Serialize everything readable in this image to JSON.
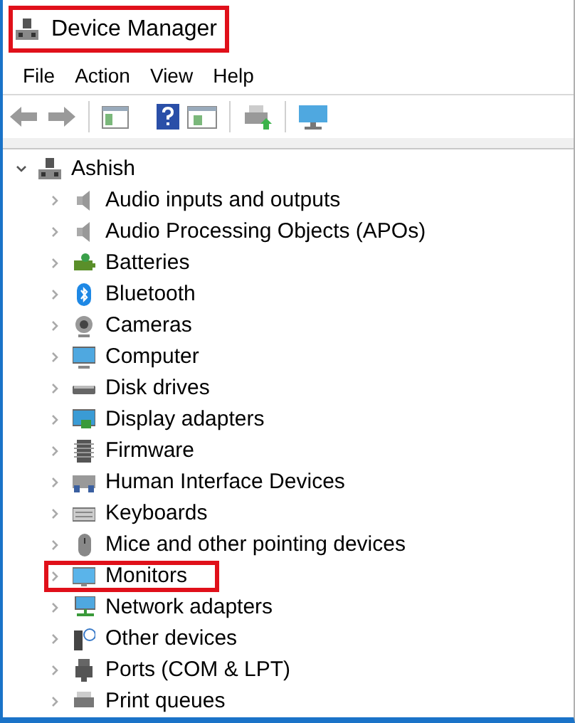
{
  "window": {
    "title": "Device Manager",
    "highlighted": true
  },
  "menu": [
    {
      "label": "File"
    },
    {
      "label": "Action"
    },
    {
      "label": "View"
    },
    {
      "label": "Help"
    }
  ],
  "tree": {
    "label": "Ashish",
    "expanded": true,
    "highlighted": false,
    "children": [
      {
        "label": "Audio inputs and outputs",
        "expanded": false,
        "highlighted": false
      },
      {
        "label": "Audio Processing Objects (APOs)",
        "expanded": false,
        "highlighted": false
      },
      {
        "label": "Batteries",
        "expanded": false,
        "highlighted": false
      },
      {
        "label": "Bluetooth",
        "expanded": false,
        "highlighted": false
      },
      {
        "label": "Cameras",
        "expanded": false,
        "highlighted": false
      },
      {
        "label": "Computer",
        "expanded": false,
        "highlighted": false
      },
      {
        "label": "Disk drives",
        "expanded": false,
        "highlighted": false
      },
      {
        "label": "Display adapters",
        "expanded": false,
        "highlighted": false
      },
      {
        "label": "Firmware",
        "expanded": false,
        "highlighted": false
      },
      {
        "label": "Human Interface Devices",
        "expanded": false,
        "highlighted": false
      },
      {
        "label": "Keyboards",
        "expanded": false,
        "highlighted": false
      },
      {
        "label": "Mice and other pointing devices",
        "expanded": false,
        "highlighted": false
      },
      {
        "label": "Monitors",
        "expanded": false,
        "highlighted": true
      },
      {
        "label": "Network adapters",
        "expanded": false,
        "highlighted": false
      },
      {
        "label": "Other devices",
        "expanded": false,
        "highlighted": false
      },
      {
        "label": "Ports (COM & LPT)",
        "expanded": false,
        "highlighted": false
      },
      {
        "label": "Print queues",
        "expanded": false,
        "highlighted": false
      }
    ]
  }
}
